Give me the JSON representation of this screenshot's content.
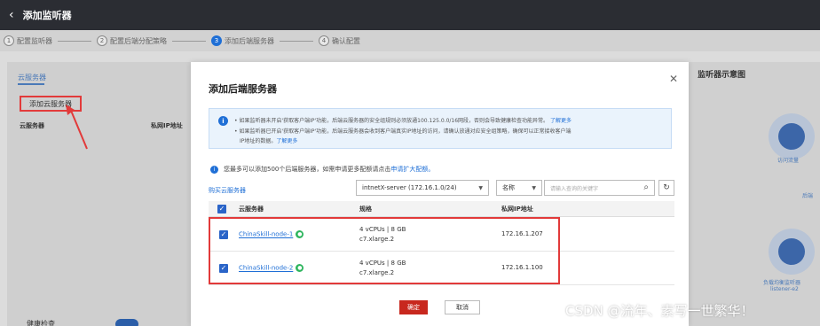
{
  "topbar": {
    "back_icon": "chevron-left-icon",
    "title": "添加监听器"
  },
  "steps": [
    {
      "num": "1",
      "label": "配置监听器"
    },
    {
      "num": "2",
      "label": "配置后端分配策略"
    },
    {
      "num": "3",
      "label": "添加后端服务器"
    },
    {
      "num": "4",
      "label": "确认配置"
    }
  ],
  "background": {
    "tab": "云服务器",
    "add_button": "添加云服务器",
    "col_server": "云服务器",
    "col_ip": "私网IP地址",
    "toggle_label": "健康检查",
    "diagram_title": "监听器示意图",
    "diagram_labels": [
      "访问流量",
      "后端",
      "负载均衡监听器",
      "listener-e2"
    ]
  },
  "modal": {
    "title": "添加后端服务器",
    "close_icon": "close-icon",
    "info_line1": "如果监听器未开启'获取客户端IP'功能，后端云服务器的安全组规则必须放通100.125.0.0/16网段，否则会导致健康检查功能异常。",
    "info_line1_link": "了解更多",
    "info_line2": "如果监听器已开启'获取客户端IP'功能，后端云服务器会收到客户端真实IP地址的访问，请确认放通对应安全组策略，确保可以正常接收客户端",
    "info_line3": "IP地址的数据。",
    "info_line3_link": "了解更多",
    "notice_text": "您最多可以添加500个后端服务器，如需申请更多配额请点击",
    "notice_link": "申请扩大配额。",
    "buy_link": "购买云服务器",
    "vpc_select": "intnetX-server (172.16.1.0/24)",
    "filter_select": "名称",
    "search_placeholder": "请输入查询的关键字",
    "search_icon": "search-icon",
    "refresh_icon": "refresh-icon",
    "columns": {
      "server": "云服务器",
      "spec": "规格",
      "ip": "私网IP地址"
    },
    "rows": [
      {
        "name": "ChinaSkill-node-1",
        "spec1": "4 vCPUs | 8 GB",
        "spec2": "c7.xlarge.2",
        "ip": "172.16.1.207",
        "checked": true
      },
      {
        "name": "ChinaSkill-node-2",
        "spec1": "4 vCPUs | 8 GB",
        "spec2": "c7.xlarge.2",
        "ip": "172.16.1.100",
        "checked": true
      }
    ],
    "ok_button": "确定",
    "cancel_button": "取消"
  },
  "watermark": "CSDN @流年、素写一世繁华！"
}
